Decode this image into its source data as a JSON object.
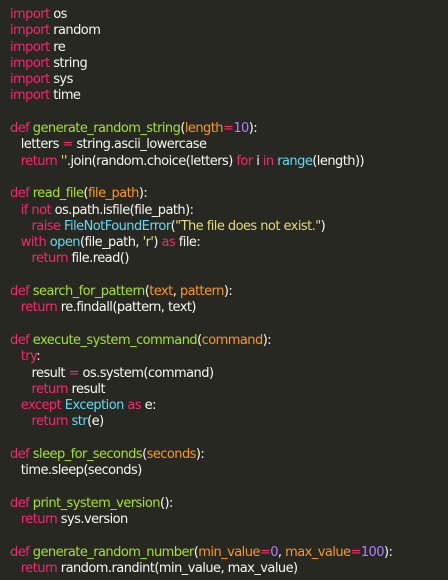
{
  "editor": {
    "colors": {
      "background": "#272822",
      "text": "#f8f8f2",
      "keyword": "#f92672",
      "function": "#a6e22e",
      "builtin": "#66d9ef",
      "string": "#e6db74",
      "number": "#ae81ff",
      "param": "#fd971f"
    },
    "lines": [
      [
        [
          "kw",
          "import"
        ],
        [
          "p",
          " os"
        ]
      ],
      [
        [
          "kw",
          "import"
        ],
        [
          "p",
          " random"
        ]
      ],
      [
        [
          "kw",
          "import"
        ],
        [
          "p",
          " re"
        ]
      ],
      [
        [
          "kw",
          "import"
        ],
        [
          "p",
          " string"
        ]
      ],
      [
        [
          "kw",
          "import"
        ],
        [
          "p",
          " sys"
        ]
      ],
      [
        [
          "kw",
          "import"
        ],
        [
          "p",
          " time"
        ]
      ],
      [],
      [
        [
          "kw",
          "def"
        ],
        [
          "p",
          " "
        ],
        [
          "fn",
          "generate_random_string"
        ],
        [
          "p",
          "("
        ],
        [
          "param",
          "length"
        ],
        [
          "kw",
          "="
        ],
        [
          "num",
          "10"
        ],
        [
          "p",
          "):"
        ]
      ],
      [
        [
          "p",
          "   letters "
        ],
        [
          "kw",
          "="
        ],
        [
          "p",
          " string.ascii_lowercase"
        ]
      ],
      [
        [
          "p",
          "   "
        ],
        [
          "kw",
          "return"
        ],
        [
          "p",
          " "
        ],
        [
          "str",
          "''"
        ],
        [
          "p",
          ".join(random.choice(letters) "
        ],
        [
          "kw",
          "for"
        ],
        [
          "p",
          " i "
        ],
        [
          "kw",
          "in"
        ],
        [
          "p",
          " "
        ],
        [
          "bi",
          "range"
        ],
        [
          "p",
          "(length))"
        ]
      ],
      [],
      [
        [
          "kw",
          "def"
        ],
        [
          "p",
          " "
        ],
        [
          "fn",
          "read_file"
        ],
        [
          "p",
          "("
        ],
        [
          "param",
          "file_path"
        ],
        [
          "p",
          "):"
        ]
      ],
      [
        [
          "p",
          "   "
        ],
        [
          "kw",
          "if not"
        ],
        [
          "p",
          " os.path.isfile(file_path):"
        ]
      ],
      [
        [
          "p",
          "      "
        ],
        [
          "kw",
          "raise"
        ],
        [
          "p",
          " "
        ],
        [
          "bi",
          "FileNotFoundError"
        ],
        [
          "p",
          "("
        ],
        [
          "str",
          "\"The file does not exist.\""
        ],
        [
          "p",
          ")"
        ]
      ],
      [
        [
          "p",
          "   "
        ],
        [
          "kw",
          "with"
        ],
        [
          "p",
          " "
        ],
        [
          "bi",
          "open"
        ],
        [
          "p",
          "(file_path, "
        ],
        [
          "str",
          "'r'"
        ],
        [
          "p",
          ") "
        ],
        [
          "kw",
          "as"
        ],
        [
          "p",
          " file:"
        ]
      ],
      [
        [
          "p",
          "      "
        ],
        [
          "kw",
          "return"
        ],
        [
          "p",
          " file.read()"
        ]
      ],
      [],
      [
        [
          "kw",
          "def"
        ],
        [
          "p",
          " "
        ],
        [
          "fn",
          "search_for_pattern"
        ],
        [
          "p",
          "("
        ],
        [
          "param",
          "text"
        ],
        [
          "p",
          ", "
        ],
        [
          "param",
          "pattern"
        ],
        [
          "p",
          "):"
        ]
      ],
      [
        [
          "p",
          "   "
        ],
        [
          "kw",
          "return"
        ],
        [
          "p",
          " re.findall(pattern, text)"
        ]
      ],
      [],
      [
        [
          "kw",
          "def"
        ],
        [
          "p",
          " "
        ],
        [
          "fn",
          "execute_system_command"
        ],
        [
          "p",
          "("
        ],
        [
          "param",
          "command"
        ],
        [
          "p",
          "):"
        ]
      ],
      [
        [
          "p",
          "   "
        ],
        [
          "kw",
          "try"
        ],
        [
          "p",
          ":"
        ]
      ],
      [
        [
          "p",
          "      result "
        ],
        [
          "kw",
          "="
        ],
        [
          "p",
          " os.system(command)"
        ]
      ],
      [
        [
          "p",
          "      "
        ],
        [
          "kw",
          "return"
        ],
        [
          "p",
          " result"
        ]
      ],
      [
        [
          "p",
          "   "
        ],
        [
          "kw",
          "except"
        ],
        [
          "p",
          " "
        ],
        [
          "bi",
          "Exception"
        ],
        [
          "p",
          " "
        ],
        [
          "kw",
          "as"
        ],
        [
          "p",
          " e:"
        ]
      ],
      [
        [
          "p",
          "      "
        ],
        [
          "kw",
          "return"
        ],
        [
          "p",
          " "
        ],
        [
          "bi",
          "str"
        ],
        [
          "p",
          "(e)"
        ]
      ],
      [],
      [
        [
          "kw",
          "def"
        ],
        [
          "p",
          " "
        ],
        [
          "fn",
          "sleep_for_seconds"
        ],
        [
          "p",
          "("
        ],
        [
          "param",
          "seconds"
        ],
        [
          "p",
          "):"
        ]
      ],
      [
        [
          "p",
          "   time.sleep(seconds)"
        ]
      ],
      [],
      [
        [
          "kw",
          "def"
        ],
        [
          "p",
          " "
        ],
        [
          "fn",
          "print_system_version"
        ],
        [
          "p",
          "():"
        ]
      ],
      [
        [
          "p",
          "   "
        ],
        [
          "kw",
          "return"
        ],
        [
          "p",
          " sys.version"
        ]
      ],
      [],
      [
        [
          "kw",
          "def"
        ],
        [
          "p",
          " "
        ],
        [
          "fn",
          "generate_random_number"
        ],
        [
          "p",
          "("
        ],
        [
          "param",
          "min_value"
        ],
        [
          "kw",
          "="
        ],
        [
          "num",
          "0"
        ],
        [
          "p",
          ", "
        ],
        [
          "param",
          "max_value"
        ],
        [
          "kw",
          "="
        ],
        [
          "num",
          "100"
        ],
        [
          "p",
          "):"
        ]
      ],
      [
        [
          "p",
          "   "
        ],
        [
          "kw",
          "return"
        ],
        [
          "p",
          " random.randint(min_value, max_value)"
        ]
      ]
    ]
  }
}
